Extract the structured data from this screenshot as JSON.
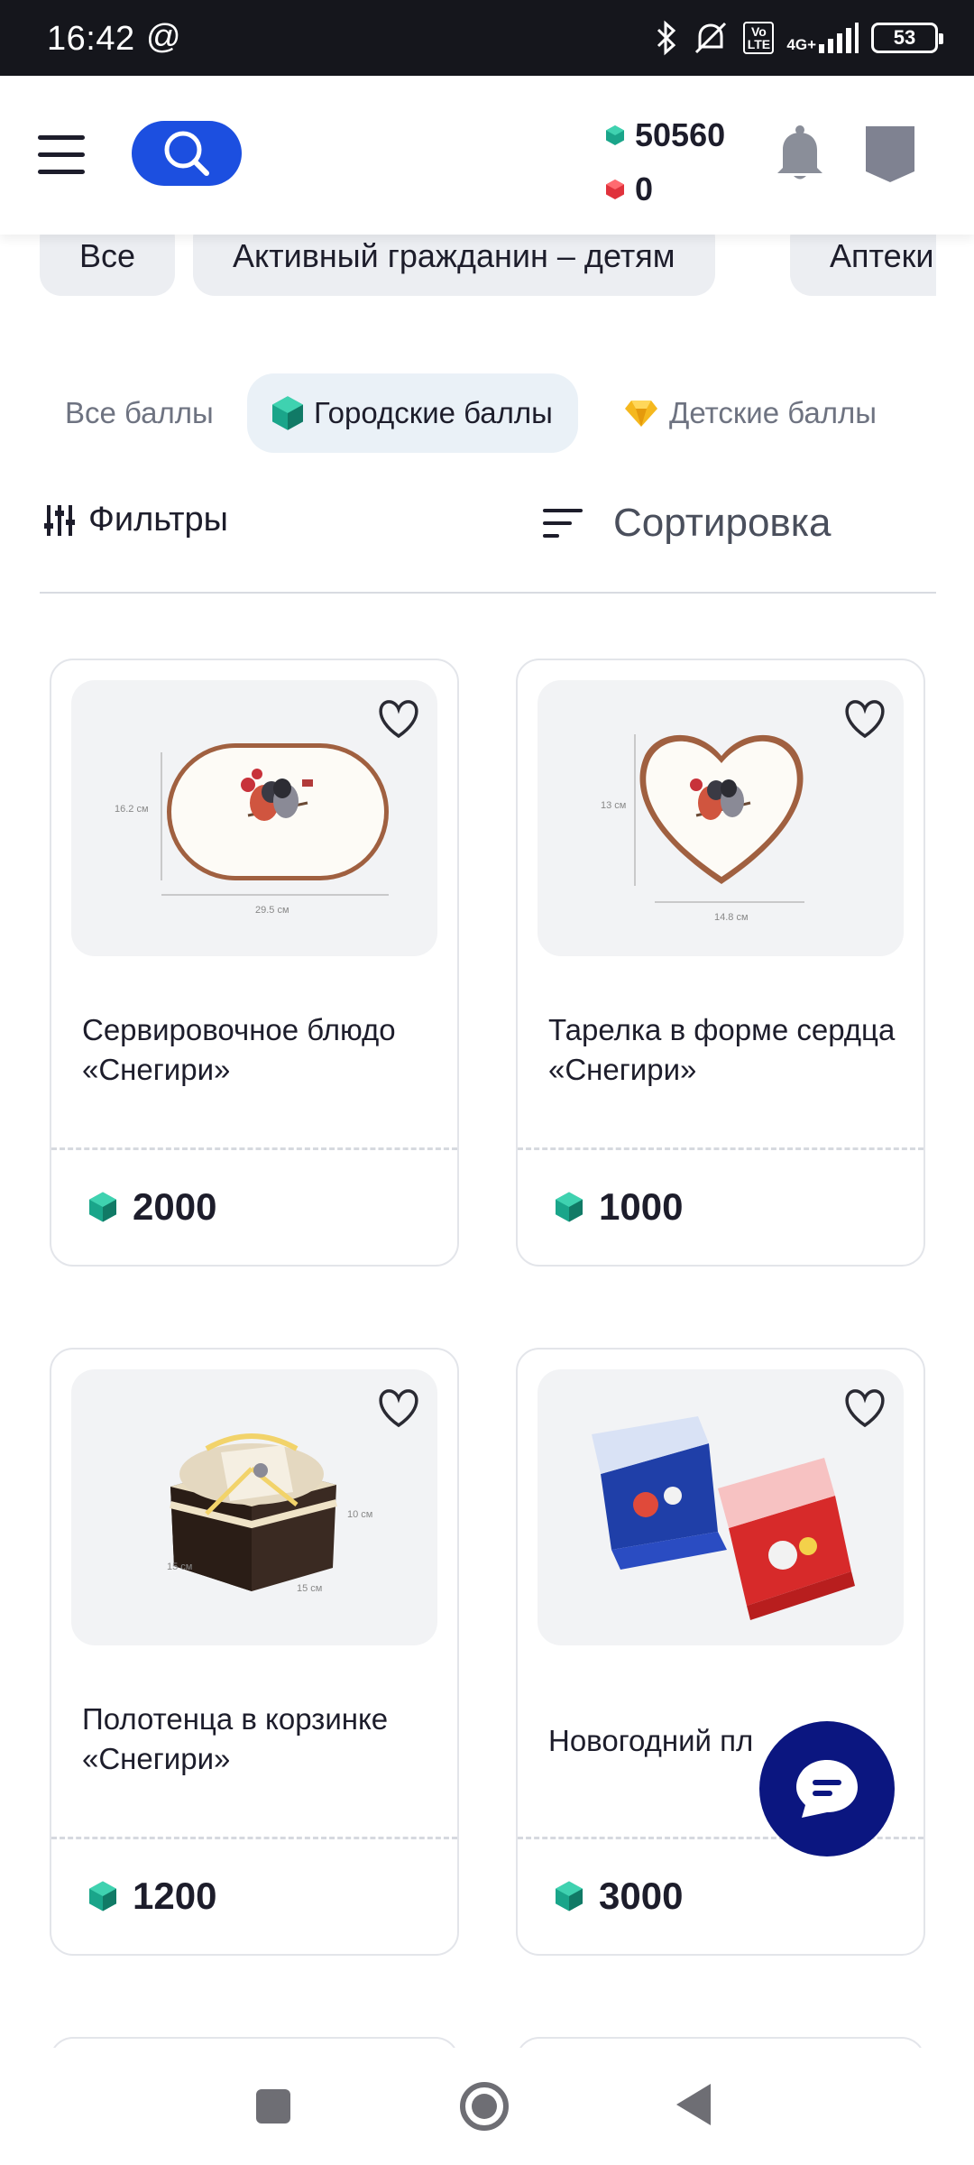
{
  "status_bar": {
    "time": "16:42",
    "at_symbol": "@",
    "network": "4G+",
    "volte": "Vo LTE",
    "battery": "53"
  },
  "header": {
    "city_points": "50560",
    "kid_points": "0"
  },
  "categories": [
    "Все",
    "Активный гражданин – детям",
    "Аптеки"
  ],
  "point_tabs": [
    {
      "label": "Все баллы",
      "active": false
    },
    {
      "label": "Городские баллы",
      "active": true
    },
    {
      "label": "Детские баллы",
      "active": false
    }
  ],
  "toolbar": {
    "filters_label": "Фильтры",
    "sort_label": "Сортировка"
  },
  "products": [
    {
      "title": "Сервировочное блюдо «Снегири»",
      "price": "2000",
      "dims": {
        "w": "29.5 см",
        "h": "16.2 см"
      }
    },
    {
      "title": "Тарелка в форме сердца «Снегири»",
      "price": "1000",
      "dims": {
        "w": "14.8 см",
        "h": "13 см"
      }
    },
    {
      "title": "Полотенца в корзинке «Снегири»",
      "price": "1200",
      "dims": {
        "a": "15 см",
        "b": "15 см",
        "c": "10 см"
      }
    },
    {
      "title": "Новогодний пл",
      "price": "3000"
    }
  ],
  "colors": {
    "accent": "#1c4fe0",
    "gem": "#1aa58a",
    "kid_gem": "#e0323c",
    "chat_fab": "#0b1680"
  }
}
